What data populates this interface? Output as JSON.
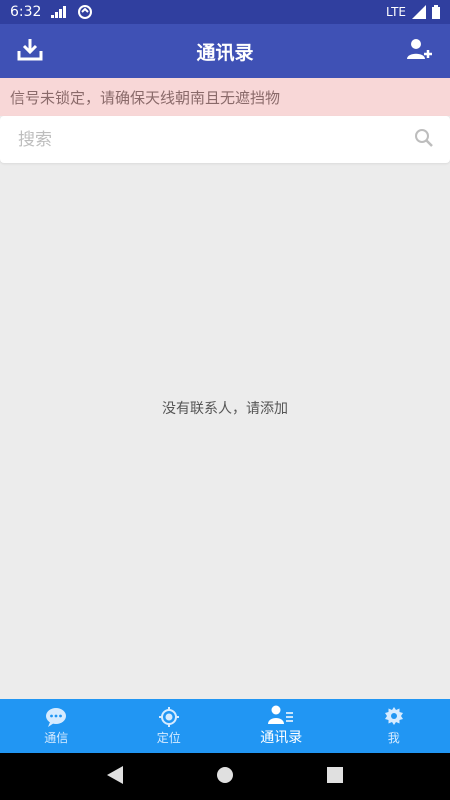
{
  "status_bar": {
    "time": "6:32",
    "network": "LTE"
  },
  "app_bar": {
    "title": "通讯录",
    "left_icon": "download-icon",
    "right_icon": "add-contact-icon"
  },
  "warning": {
    "text": "信号未锁定，请确保天线朝南且无遮挡物"
  },
  "search": {
    "placeholder": "搜索",
    "value": ""
  },
  "empty_state": {
    "text": "没有联系人，请添加"
  },
  "bottom_nav": {
    "items": [
      {
        "label": "通信",
        "icon": "chat-icon",
        "active": false
      },
      {
        "label": "定位",
        "icon": "location-icon",
        "active": false
      },
      {
        "label": "通讯录",
        "icon": "contacts-icon",
        "active": true
      },
      {
        "label": "我",
        "icon": "gear-icon",
        "active": false
      }
    ]
  },
  "colors": {
    "status_bar": "#303f9f",
    "app_bar": "#3f51b5",
    "bottom_nav": "#2196f3",
    "warning_bg": "#f8d7d7"
  }
}
